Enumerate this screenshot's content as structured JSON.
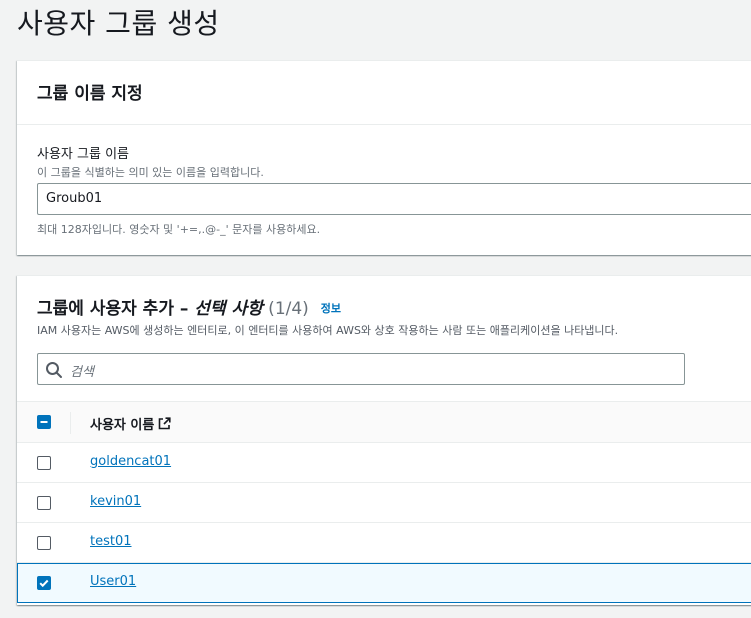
{
  "page": {
    "title": "사용자 그룹 생성"
  },
  "group_name_panel": {
    "header": "그룹 이름 지정",
    "field_label": "사용자 그룹 이름",
    "field_description": "이 그룹을 식별하는 의미 있는 이름을 입력합니다.",
    "input_value": "Groub01",
    "constraint": "최대 128자입니다. 영숫자 및 '+=,.@-_' 문자를 사용하세요."
  },
  "add_users_panel": {
    "title_main": "그룹에 사용자 추가 – ",
    "title_optional": "선택 사항",
    "title_count": " (1/4)",
    "info_link": "정보",
    "description": "IAM 사용자는 AWS에 생성하는 엔터티로, 이 엔터티를 사용하여 AWS와 상호 작용하는 사람 또는 애플리케이션을 나타냅니다.",
    "search_placeholder": "검색",
    "column_header": "사용자 이름",
    "users": [
      {
        "name": "goldencat01",
        "checked": false
      },
      {
        "name": "kevin01",
        "checked": false
      },
      {
        "name": "test01",
        "checked": false
      },
      {
        "name": "User01",
        "checked": true
      }
    ]
  },
  "icons": {
    "search": "search-icon",
    "external_link": "external-link-icon",
    "checkbox_checked": "check-icon",
    "checkbox_mixed": "minus-icon"
  },
  "colors": {
    "accent": "#0073bb",
    "background": "#f2f3f3",
    "selected_row": "#f1faff"
  }
}
